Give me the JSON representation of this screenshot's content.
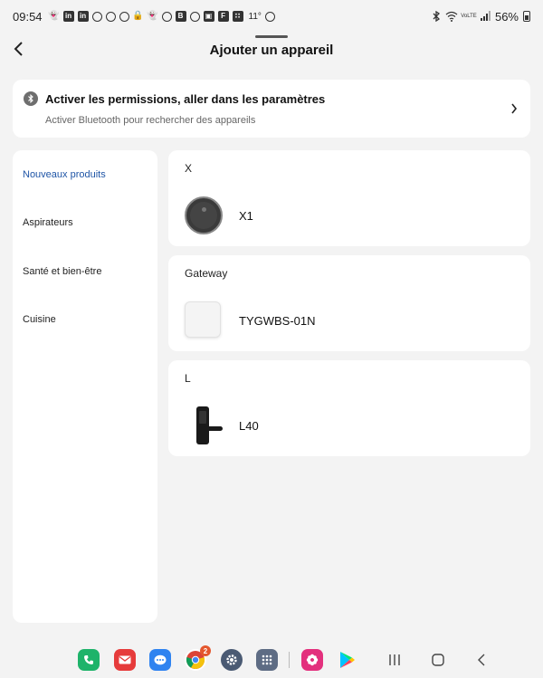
{
  "status_bar": {
    "time": "09:54",
    "temperature": "11°",
    "battery": "56%",
    "icons_left": [
      "snapchat-icon",
      "linkedin-icon",
      "linkedin-icon",
      "chrome-icon",
      "chrome-icon",
      "chrome-icon",
      "lock-icon",
      "snapchat-icon",
      "chat-icon",
      "bbc-icon",
      "circle-icon",
      "gallery-icon",
      "flipboard-icon",
      "grid-icon"
    ],
    "icons_right": [
      "bluetooth-icon",
      "wifi-icon",
      "volte-icon",
      "signal-icon",
      "battery-icon"
    ]
  },
  "header": {
    "title": "Ajouter un appareil"
  },
  "bluetooth_banner": {
    "title": "Activer les permissions, aller dans les paramètres",
    "subtitle": "Activer Bluetooth pour rechercher des appareils"
  },
  "sidebar": {
    "items": [
      {
        "label": "Nouveaux produits",
        "active": true
      },
      {
        "label": "Aspirateurs",
        "active": false
      },
      {
        "label": "Santé et bien-être",
        "active": false
      },
      {
        "label": "Cuisine",
        "active": false
      }
    ]
  },
  "device_groups": [
    {
      "category": "X",
      "devices": [
        {
          "name": "X1",
          "icon": "robot-vacuum-image"
        }
      ]
    },
    {
      "category": "Gateway",
      "devices": [
        {
          "name": "TYGWBS-01N",
          "icon": "gateway-image"
        }
      ]
    },
    {
      "category": "L",
      "devices": [
        {
          "name": "L40",
          "icon": "smart-lock-image"
        }
      ]
    }
  ],
  "dock": {
    "apps": [
      {
        "name": "phone-app",
        "color": "#1eb36a"
      },
      {
        "name": "email-app",
        "color": "#e63b3b"
      },
      {
        "name": "messages-app",
        "color": "#2f83f0"
      },
      {
        "name": "chrome-app",
        "color": "#f2c318",
        "badge": "2"
      },
      {
        "name": "settings-app",
        "color": "#4a5a73"
      },
      {
        "name": "apps-grid",
        "color": "#5e6c84"
      },
      {
        "name": "flower-app",
        "color": "#e3307d"
      },
      {
        "name": "play-store-app",
        "color": "#ffffff"
      }
    ]
  },
  "colors": {
    "accent": "#1f55a6",
    "background": "#f3f3f3",
    "card": "#ffffff"
  }
}
